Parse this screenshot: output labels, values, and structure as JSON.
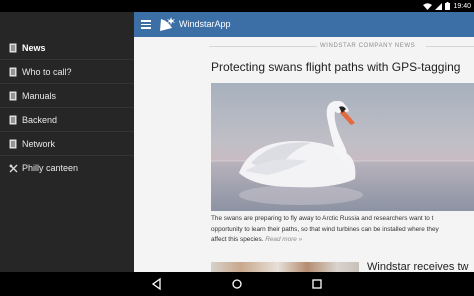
{
  "status_bar": {
    "time": "19:40"
  },
  "drawer": {
    "items": [
      {
        "label": "News",
        "icon": "document-icon",
        "active": true
      },
      {
        "label": "Who to call?",
        "icon": "document-icon"
      },
      {
        "label": "Manuals",
        "icon": "document-icon"
      },
      {
        "label": "Backend",
        "icon": "document-icon"
      },
      {
        "label": "Network",
        "icon": "document-icon"
      },
      {
        "label": "Philly canteen",
        "icon": "utensils-icon"
      }
    ]
  },
  "toolbar": {
    "title": "WindstarApp",
    "menu_icon": "hamburger-icon",
    "logo_icon": "windstar-logo-icon",
    "color": "#3b6fa6"
  },
  "content": {
    "section_header": "WINDSTAR COMPANY NEWS",
    "article": {
      "title": "Protecting swans flight paths with GPS-tagging",
      "text_lines": [
        "The swans are preparing to fly away to Arctic Russia and researchers want to t",
        "opportunity to learn their paths, so that wind turbines can be installed where they",
        "affect this species."
      ],
      "read_more": "Read more »"
    },
    "article2": {
      "title": "Windstar receives tw"
    }
  },
  "nav_bar": {
    "back_icon": "back-triangle-icon",
    "home_icon": "home-circle-icon",
    "recents_icon": "recents-square-icon"
  }
}
